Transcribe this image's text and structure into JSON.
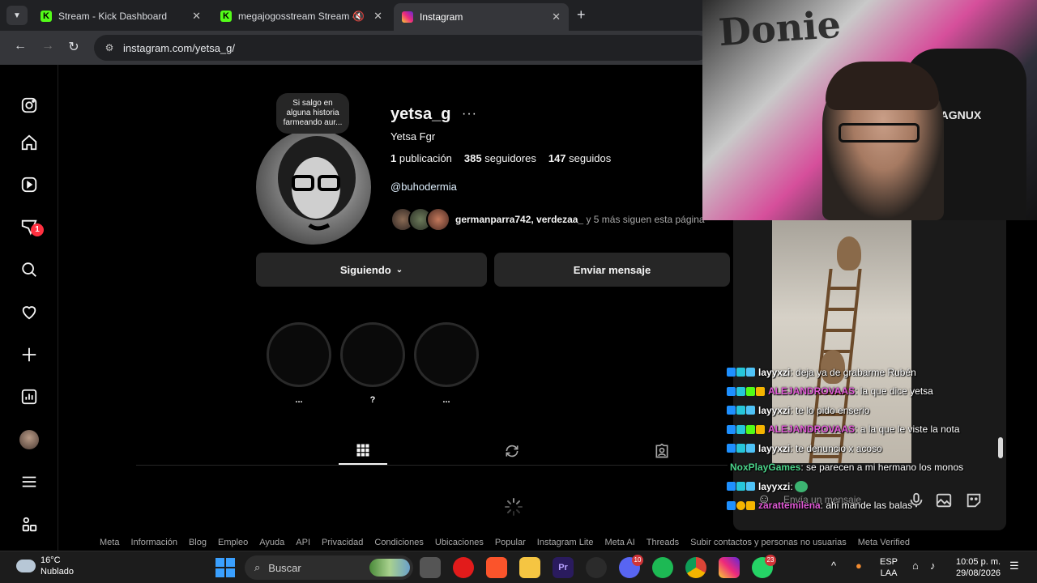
{
  "browser": {
    "tabs": [
      {
        "title": "Stream - Kick Dashboard",
        "favicon": "kick-icon"
      },
      {
        "title": "megajogosstream Stream -",
        "favicon": "kick-icon"
      },
      {
        "title": "Instagram",
        "favicon": "instagram-icon"
      }
    ],
    "url": "instagram.com/yetsa_g/"
  },
  "profile": {
    "note": "Si salgo en alguna historia farmeando aur...",
    "username": "yetsa_g",
    "more": "···",
    "full_name": "Yetsa Fgr",
    "posts_count": "1",
    "posts_label": "publicación",
    "followers_count": "385",
    "followers_label": "seguidores",
    "following_count": "147",
    "following_label": "seguidos",
    "bio_link": "@buhodermia",
    "followed_by_names": "germanparra742, verdezaa_",
    "followed_by_rest": " y 5 más siguen esta página",
    "following_button": "Siguiendo",
    "message_button": "Enviar mensaje",
    "highlights": [
      {
        "label": "..."
      },
      {
        "label": "?"
      },
      {
        "label": "..."
      }
    ],
    "notification_count": "1"
  },
  "footer_links": [
    "Meta",
    "Información",
    "Blog",
    "Empleo",
    "Ayuda",
    "API",
    "Privacidad",
    "Condiciones",
    "Ubicaciones",
    "Popular",
    "Instagram Lite",
    "Meta AI",
    "Threads",
    "Subir contactos y personas no usuarias",
    "Meta Verified"
  ],
  "stream": {
    "chair_brand": "MAGNUX",
    "wall_text": "Donie",
    "chat_placeholder": "Envía un mensaje",
    "chat": [
      {
        "user": "layyxzi",
        "color": "#ffffff",
        "text": " : deja ya de grabarme Rubén"
      },
      {
        "user": "ALEJANDROVAAS",
        "color": "#e05ad6",
        "text": " : la que dice yetsa"
      },
      {
        "user": "layyxzi",
        "color": "#ffffff",
        "text": " : te lo pido enserio"
      },
      {
        "user": "ALEJANDROVAAS",
        "color": "#e05ad6",
        "text": " : a la que le viste la nota"
      },
      {
        "user": "layyxzi",
        "color": "#ffffff",
        "text": " : te denuncio x acoso"
      },
      {
        "user": "NoxPlayGames",
        "color": "#4bd48a",
        "text": " : se parecen a mi hermano los monos"
      },
      {
        "user": "layyxzi",
        "color": "#ffffff",
        "text": " : "
      },
      {
        "user": "zarattemilena",
        "color": "#e05ad6",
        "text": " : ahi mande las balas"
      }
    ]
  },
  "taskbar": {
    "temperature": "16°C",
    "weather": "Nublado",
    "search_placeholder": "Buscar",
    "language": "ESP",
    "layout": "LAA",
    "time": "10:05 p. m.",
    "date": "29/08/2026",
    "badges": {
      "discord": "10",
      "whatsapp": "23"
    }
  },
  "colors": {
    "accent_blue": "#0095f6",
    "notification_red": "#ff3040",
    "kick_green": "#53fc18"
  }
}
